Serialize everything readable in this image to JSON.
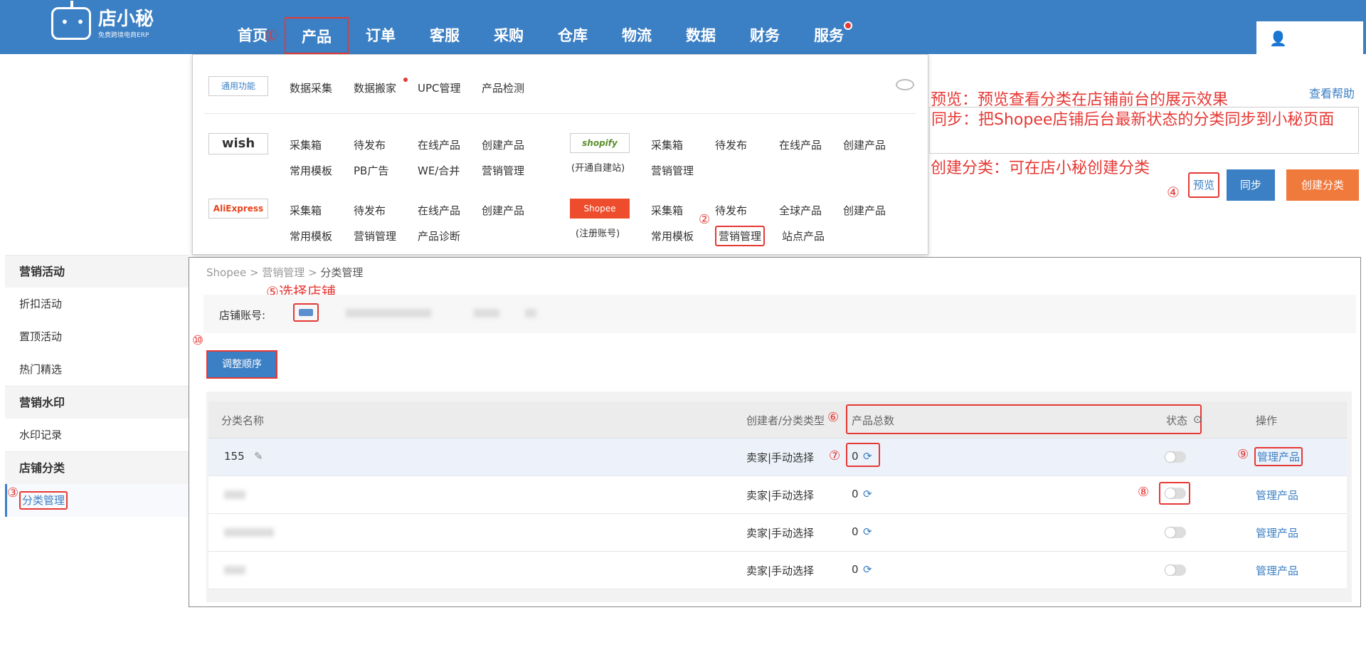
{
  "brand": {
    "name": "店小秘",
    "tagline": "免费跨境电商ERP"
  },
  "nav": {
    "items": [
      "首页",
      "产品",
      "订单",
      "客服",
      "采购",
      "仓库",
      "物流",
      "数据",
      "财务",
      "服务"
    ],
    "active": "产品"
  },
  "dropdown": {
    "general_badge": "通用功能",
    "general_links": [
      "数据采集",
      "数据搬家",
      "UPC管理",
      "产品检测"
    ],
    "wish": {
      "badge": "wish",
      "row1": [
        "采集箱",
        "待发布",
        "在线产品",
        "创建产品"
      ],
      "row2": [
        "常用模板",
        "PB广告",
        "WE/合并",
        "营销管理"
      ]
    },
    "shopify": {
      "badge": "shopify",
      "sub": "(开通自建站)",
      "row1": [
        "采集箱",
        "待发布",
        "在线产品",
        "创建产品"
      ],
      "row2": [
        "营销管理"
      ]
    },
    "aliexpress": {
      "badge": "AliExpress",
      "row1": [
        "采集箱",
        "待发布",
        "在线产品",
        "创建产品"
      ],
      "row2": [
        "常用模板",
        "营销管理",
        "产品诊断"
      ]
    },
    "shopee": {
      "badge": "Shopee",
      "sub": "(注册账号)",
      "row1": [
        "采集箱",
        "待发布",
        "全球产品",
        "创建产品"
      ],
      "row2": [
        "常用模板",
        "营销管理",
        "站点产品"
      ]
    }
  },
  "annotations": {
    "preview": "预览：预览查看分类在店铺前台的展示效果",
    "sync": "同步：把Shopee店铺后台最新状态的分类同步到小秘页面",
    "create": "创建分类：可在店小秘创建分类",
    "select_shop": "⑤选择店铺",
    "n1": "①",
    "n2": "②",
    "n3": "③",
    "n4": "④",
    "n6": "⑥",
    "n7": "⑦",
    "n8": "⑧",
    "n9": "⑨",
    "n10": "⑩"
  },
  "help_link": "查看帮助",
  "actions": {
    "preview": "预览",
    "sync": "同步",
    "create": "创建分类"
  },
  "sidebar": {
    "sections": [
      {
        "title": "营销活动",
        "items": [
          "折扣活动",
          "置顶活动",
          "热门精选"
        ]
      },
      {
        "title": "营销水印",
        "items": [
          "水印记录"
        ]
      },
      {
        "title": "店铺分类",
        "items": [
          "分类管理"
        ]
      }
    ]
  },
  "breadcrumb": [
    "Shopee",
    "营销管理",
    "分类管理"
  ],
  "shop_label": "店铺账号:",
  "adjust_button": "调整顺序",
  "table": {
    "headers": [
      "分类名称",
      "创建者/分类类型",
      "产品总数",
      "状态",
      "操作"
    ],
    "rows": [
      {
        "name": "155",
        "type": "卖家|手动选择",
        "count": "0",
        "action": "管理产品"
      },
      {
        "name": "",
        "type": "卖家|手动选择",
        "count": "0",
        "action": "管理产品"
      },
      {
        "name": "",
        "type": "卖家|手动选择",
        "count": "0",
        "action": "管理产品"
      },
      {
        "name": "",
        "type": "卖家|手动选择",
        "count": "0",
        "action": "管理产品"
      }
    ]
  },
  "colors": {
    "primary": "#3b7fc4",
    "accent": "#f0793c",
    "annotation": "#e53935"
  }
}
